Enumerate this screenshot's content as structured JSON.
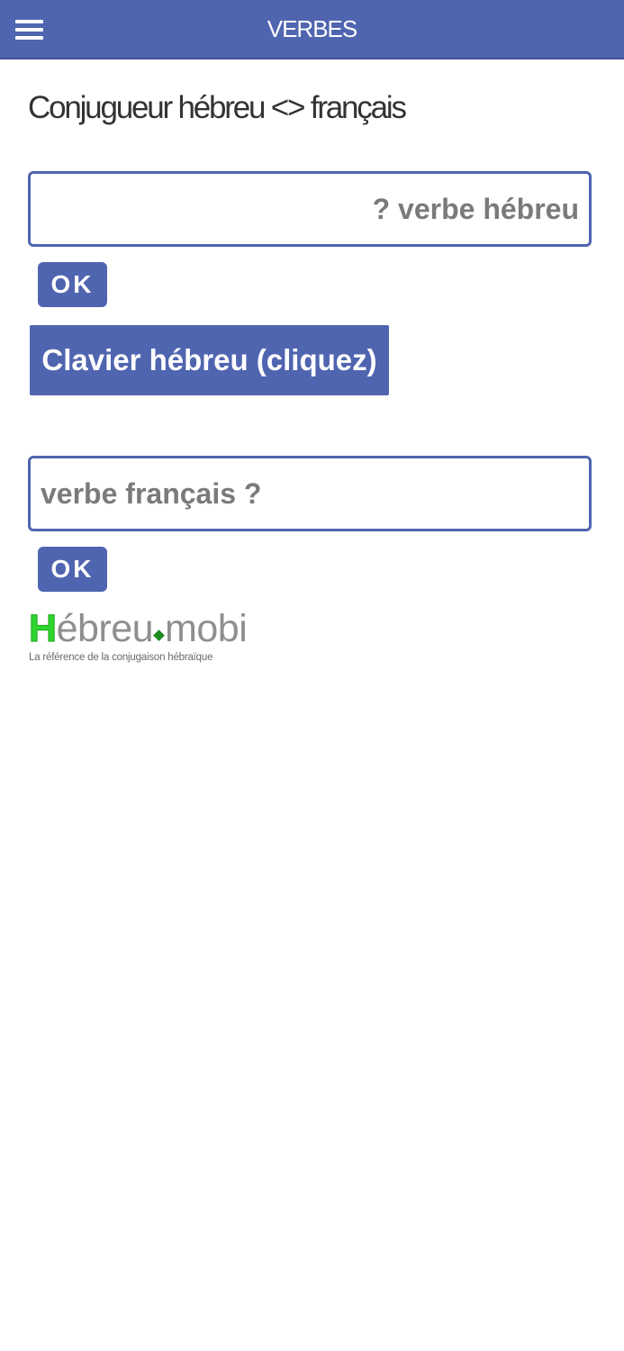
{
  "header": {
    "title": "VERBES",
    "menu_icon": "hamburger-menu-icon",
    "background_color": "#5065b0"
  },
  "main": {
    "heading": "Conjugueur hébreu <> français",
    "hebrew_search": {
      "placeholder": "verbe hébreu ?",
      "value": "",
      "ok_label": "OK"
    },
    "keyboard_button_label": "Clavier hébreu (cliquez)",
    "french_search": {
      "placeholder": "verbe français ?",
      "value": "",
      "ok_label": "OK"
    }
  },
  "logo": {
    "initial": "H",
    "word_part1": "ébreu",
    "word_part2": "mobi",
    "tagline": "La référence de la conjugaison hébraïque",
    "initial_color": "#2fd62f",
    "word_color": "#8f8f8f"
  }
}
